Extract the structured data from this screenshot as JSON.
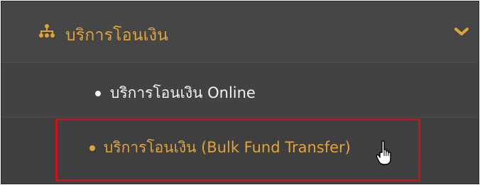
{
  "menu": {
    "header": {
      "label": "บริการโอนเงิน",
      "icon": "network-nodes-icon",
      "toggle_icon": "chevron-down-icon"
    },
    "items": [
      {
        "label": "บริการโอนเงิน Online"
      },
      {
        "label": "บริการโอนเงิน (Bulk Fund Transfer)"
      }
    ]
  },
  "colors": {
    "accent": "#e0a53a",
    "highlight": "#d0101a",
    "panel_bg": "#3c3c3c",
    "text_light": "#f2f2f2"
  }
}
